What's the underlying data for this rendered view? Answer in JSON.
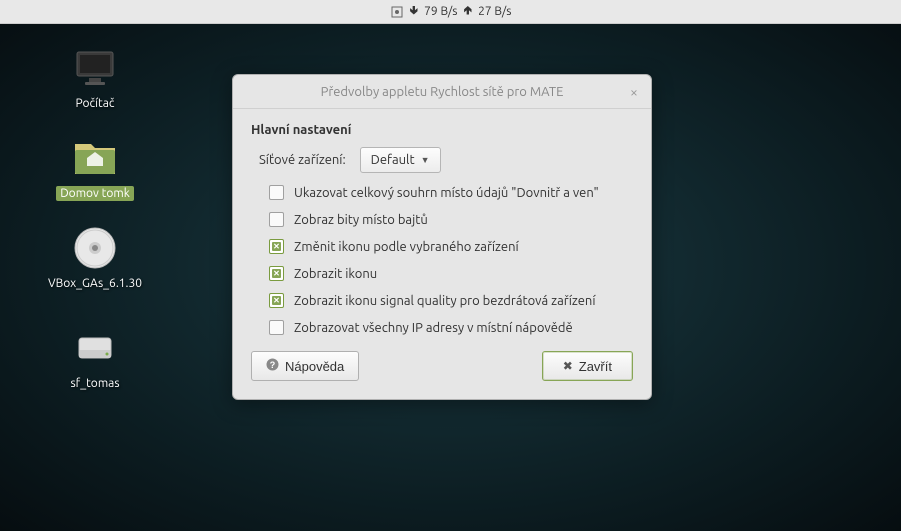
{
  "panel": {
    "down_speed": "79 B/s",
    "up_speed": "27 B/s"
  },
  "desktop_icons": {
    "computer": "Počítač",
    "home": "Domov tomk",
    "disc": "VBox_GAs_6.1.30",
    "drive": "sf_tomas"
  },
  "dialog": {
    "title": "Předvolby appletu Rychlost sítě pro MATE",
    "section_title": "Hlavní nastavení",
    "device_label": "Síťové zařízení:",
    "device_value": "Default",
    "options": [
      {
        "label": "Ukazovat celkový souhrn místo údajů \"Dovnitř a ven\"",
        "checked": false
      },
      {
        "label": "Zobraz bity místo bajtů",
        "checked": false
      },
      {
        "label": "Změnit ikonu podle vybraného zařízení",
        "checked": true
      },
      {
        "label": "Zobrazit ikonu",
        "checked": true
      },
      {
        "label": "Zobrazit ikonu signal quality pro bezdrátová zařízení",
        "checked": true
      },
      {
        "label": "Zobrazovat všechny IP adresy v místní nápovědě",
        "checked": false
      }
    ],
    "help_button": "Nápověda",
    "close_button": "Zavřít"
  }
}
